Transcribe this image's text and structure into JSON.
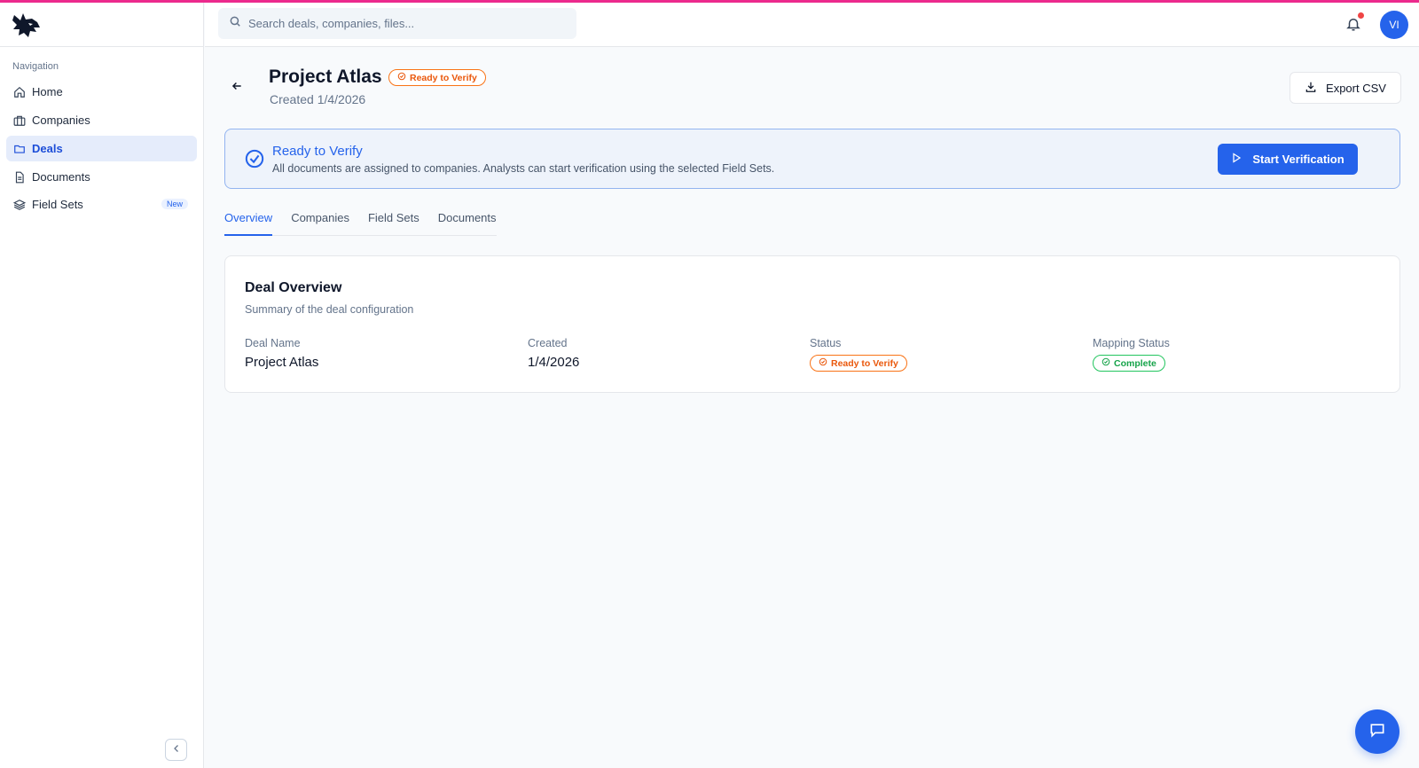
{
  "sidebar": {
    "heading": "Navigation",
    "items": [
      {
        "label": "Home",
        "icon": "home-icon"
      },
      {
        "label": "Companies",
        "icon": "briefcase-icon"
      },
      {
        "label": "Deals",
        "icon": "folder-icon",
        "active": true
      },
      {
        "label": "Documents",
        "icon": "document-icon"
      },
      {
        "label": "Field Sets",
        "icon": "layers-icon",
        "badge": "New"
      }
    ]
  },
  "topbar": {
    "search_placeholder": "Search deals, companies, files...",
    "avatar_initials": "VI",
    "notification_dot_color": "#ef4444"
  },
  "header": {
    "title": "Project Atlas",
    "status_badge": "Ready to Verify",
    "created": "Created 1/4/2026",
    "export_label": "Export CSV"
  },
  "alert": {
    "title": "Ready to Verify",
    "text": "All documents are assigned to companies. Analysts can start verification using the selected Field Sets.",
    "action_label": "Start Verification"
  },
  "tabs": [
    {
      "label": "Overview",
      "active": true
    },
    {
      "label": "Companies"
    },
    {
      "label": "Field Sets"
    },
    {
      "label": "Documents"
    }
  ],
  "overview": {
    "title": "Deal Overview",
    "subtitle": "Summary of the deal configuration",
    "fields": [
      {
        "label": "Deal Name",
        "value": "Project Atlas"
      },
      {
        "label": "Created",
        "value": "1/4/2026"
      },
      {
        "label": "Status",
        "badge": "Ready to Verify"
      },
      {
        "label": "Mapping Status",
        "badge": "Complete"
      }
    ]
  },
  "colors": {
    "accent": "#2563eb",
    "top_line": "#ec2a8d",
    "warning": "#ea580c",
    "success": "#16a34a"
  }
}
